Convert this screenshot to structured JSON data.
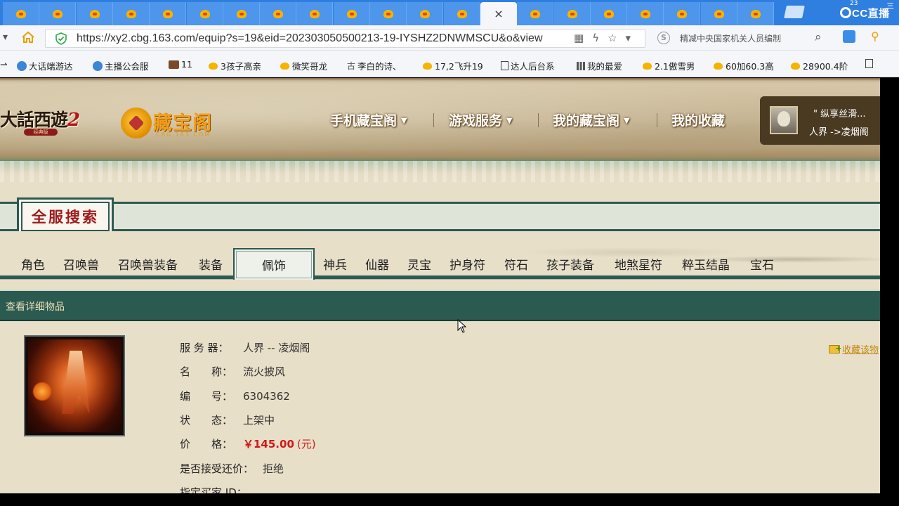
{
  "browser": {
    "tab_count_left": 13,
    "tab_count_right": 7,
    "active_tab_close": "×",
    "url": "https://xy2.cbg.163.com/equip?s=19&eid=202303050500213-19-IYSHZ2DNWMSCU&o&view",
    "search_text": "精减中央国家机关人员编制",
    "overlay_badge": "CC直播",
    "overlay_corner_a": "23",
    "overlay_corner_b": "三"
  },
  "bookmarks": [
    {
      "label": "大话端游达",
      "icon": "blue"
    },
    {
      "label": "主播公会服",
      "icon": "blue"
    },
    {
      "label": "11",
      "icon": "game"
    },
    {
      "label": "3孩子高亲",
      "icon": "chick"
    },
    {
      "label": "微笑哥龙",
      "icon": "chick"
    },
    {
      "label": "李白的诗、",
      "icon": "char"
    },
    {
      "label": "17,2飞升19",
      "icon": "chick"
    },
    {
      "label": "达人后台系",
      "icon": "doc"
    },
    {
      "label": "我的最爱",
      "icon": "grid"
    },
    {
      "label": "2.1傲雪男",
      "icon": "chick"
    },
    {
      "label": "60加60.3高",
      "icon": "chick"
    },
    {
      "label": "28900.4阶",
      "icon": "chick"
    }
  ],
  "site": {
    "game_logo": "大話西遊",
    "game_logo_num": "2",
    "game_logo_sub": "经典版",
    "cbg_name": "藏宝阁",
    "cbg_domain": "CBG.163.COM",
    "nav": [
      {
        "label": "手机藏宝阁",
        "has_caret": true
      },
      {
        "label": "游戏服务",
        "has_caret": true
      },
      {
        "label": "我的藏宝阁",
        "has_caret": true
      },
      {
        "label": "我的收藏",
        "has_caret": false
      }
    ],
    "user_name": "\" 纵享丝滑...",
    "user_server": "人界 ->凌烟阁"
  },
  "search": {
    "title": "全服搜索",
    "categories": [
      "角色",
      "召唤兽",
      "召唤兽装备",
      "装备",
      "佩饰",
      "神兵",
      "仙器",
      "灵宝",
      "护身符",
      "符石",
      "孩子装备",
      "地煞星符",
      "粹玉结晶",
      "宝石"
    ],
    "active_category": "佩饰"
  },
  "detail": {
    "bar_label": "查看详细物品",
    "fav_label": "收藏该物",
    "fields": [
      {
        "key": "服 务 器：",
        "value": "人界 -- 凌烟阁"
      },
      {
        "key": "名　　称：",
        "value": "流火披风"
      },
      {
        "key": "编　　号：",
        "value": "6304362"
      },
      {
        "key": "状　　态：",
        "value": "上架中"
      },
      {
        "key": "价　　格：",
        "value": "￥145.00",
        "unit": "(元)"
      },
      {
        "key": "是否接受还价：",
        "value": "拒绝"
      },
      {
        "key": "指定买家 ID：",
        "value": ""
      }
    ]
  },
  "colors": {
    "tab_bar": "#2f7fe0",
    "site_green": "#2c5a52",
    "price_red": "#d01818",
    "cbg_gold": "#f0a020"
  }
}
